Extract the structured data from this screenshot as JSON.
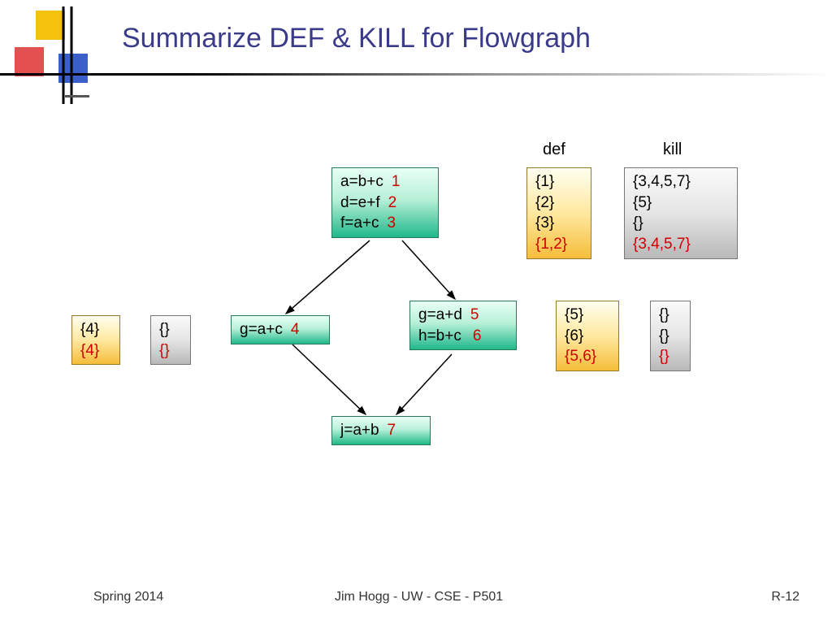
{
  "title": "Summarize DEF & KILL for Flowgraph",
  "headers": {
    "def": "def",
    "kill": "kill"
  },
  "nodes": {
    "b1": {
      "l1e": "a=b+c",
      "l1n": "1",
      "l2e": "d=e+f",
      "l2n": "2",
      "l3e": "f=a+c",
      "l3n": "3"
    },
    "b2": {
      "l1e": "g=a+c",
      "l1n": "4"
    },
    "b3": {
      "l1e": "g=a+d",
      "l1n": "5",
      "l2e": "h=b+c",
      "l2n": "6"
    },
    "b4": {
      "l1e": "j=a+b",
      "l1n": "7"
    }
  },
  "def": {
    "b1": {
      "l1": "{1}",
      "l2": "{2}",
      "l3": "{3}",
      "sum": "{1,2}"
    },
    "b2": {
      "l1": "{4}",
      "sum": "{4}"
    },
    "b3": {
      "l1": "{5}",
      "l2": "{6}",
      "sum": "{5,6}"
    },
    "b4_omitted": ""
  },
  "kill": {
    "b1": {
      "l1": "{3,4,5,7}",
      "l2": "{5}",
      "l3": "{}",
      "sum": "{3,4,5,7}"
    },
    "b2": {
      "l1": "{}",
      "sum": "{}"
    },
    "b3": {
      "l1": "{}",
      "l2": "{}",
      "sum": "{}"
    }
  },
  "footer": {
    "left": "Spring 2014",
    "center": "Jim Hogg - UW - CSE - P501",
    "right": "R-12"
  }
}
